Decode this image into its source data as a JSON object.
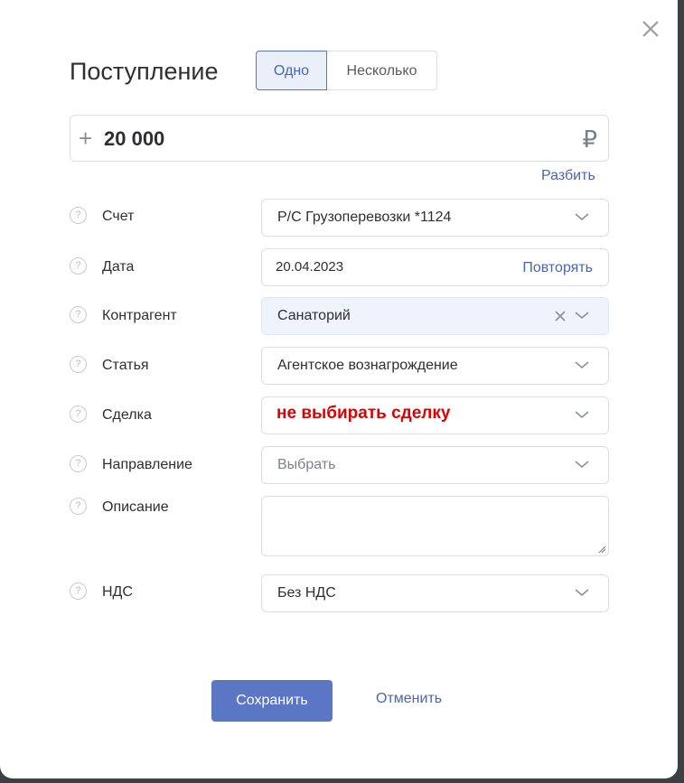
{
  "modal": {
    "title": "Поступление",
    "tabs": [
      {
        "label": "Одно",
        "active": true
      },
      {
        "label": "Несколько",
        "active": false
      }
    ]
  },
  "amount": {
    "sign": "+",
    "value": "20 000",
    "currency": "₽",
    "split_label": "Разбить"
  },
  "fields": {
    "account": {
      "label": "Счет",
      "value": "Р/С Грузоперевозки *1124"
    },
    "date": {
      "label": "Дата",
      "value": "20.04.2023",
      "repeat_label": "Повторять"
    },
    "counterparty": {
      "label": "Контрагент",
      "value": "Санаторий"
    },
    "category": {
      "label": "Статья",
      "value": "Агентское вознагрождение"
    },
    "deal": {
      "label": "Сделка",
      "annotation": "не выбирать сделку"
    },
    "direction": {
      "label": "Направление",
      "placeholder": "Выбрать"
    },
    "description": {
      "label": "Описание",
      "value": ""
    },
    "vat": {
      "label": "НДС",
      "value": "Без НДС"
    }
  },
  "help_glyph": "?",
  "actions": {
    "save_label": "Сохранить",
    "cancel_label": "Отменить"
  },
  "colors": {
    "accent": "#5c76c6",
    "link": "#4a64b8",
    "annotation": "#e00000",
    "selected_field_bg": "#eef3fc"
  },
  "icons": {
    "close": "close-icon",
    "chevron": "chevron-down-icon",
    "clear": "clear-icon",
    "help": "help-icon"
  }
}
